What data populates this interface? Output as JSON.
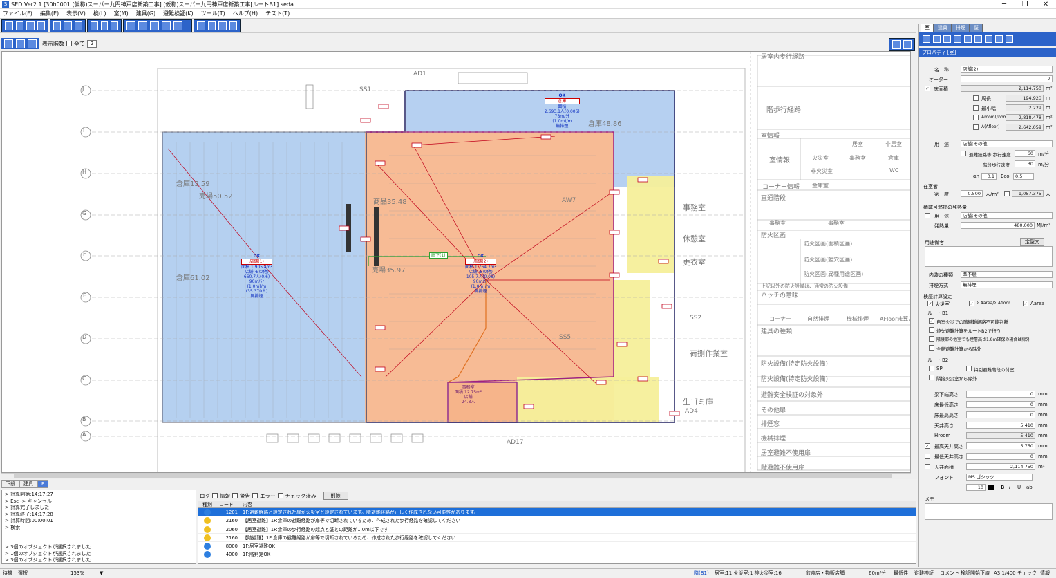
{
  "window": {
    "title": "SED Ver2.1 [30h0001 (仮称)スーパー九円神戸店新築工事] (仮称)スーパー九円神戸店新築工事[ルートB1].seda",
    "min": "─",
    "max": "❐",
    "close": "✕"
  },
  "menu": [
    "ファイル(F)",
    "編集(E)",
    "表示(V)",
    "検(L)",
    "室(M)",
    "建具(G)",
    "避難検証(K)",
    "ツール(T)",
    "ヘルプ(H)",
    "テスト(T)"
  ],
  "toolbar2": {
    "show_label": "表示階数",
    "all_label": "全て",
    "floor_value": "2"
  },
  "plan": {
    "grid_rows": [
      "J",
      "I",
      "H",
      "G",
      "F",
      "E",
      "D",
      "C",
      "B",
      "A"
    ],
    "room_large": {
      "status": "OK",
      "name": "店舗(1)",
      "line1": "面積 1,905.4m²",
      "line2": "店舗(その他)",
      "line3": "660.7人(0.6)",
      "line4": "90m/分",
      "line5": "(1.0m)/m",
      "line6": "(35.370人)",
      "line7": "無排煙"
    },
    "room_sales": {
      "status": "OK",
      "name": "店舗(2)",
      "line1": "面積 1,764.7m²",
      "line2": "店舗(その他)",
      "line3": "105.7人(0.06)",
      "line4": "90m/分",
      "line5": "(1.0m)/m",
      "line6": "無排煙"
    },
    "room_stock": {
      "status": "OK",
      "name": "倉庫",
      "line1": "面積",
      "line2": "2,693.1人(0.006)",
      "line3": "78m/分",
      "line4": "(1.0m)/m",
      "line5": "無排煙"
    },
    "room_small": {
      "name": "事務室",
      "line1": "面積 12.75m²",
      "line2": "店舗",
      "line3": "24.8人"
    },
    "corridor_tag": "廊下(1)",
    "labels": [
      "商品35.48",
      "売場50.52",
      "倉庫61.02",
      "売場35.97",
      "倉庫48.86",
      "倉庫13.59",
      "AW7",
      "SS2",
      "SS1",
      "SS5",
      "AD1",
      "AD4",
      "AD17",
      "事務室",
      "休憩室",
      "更衣室",
      "荷捌作業室",
      "生ゴミ庫"
    ]
  },
  "legend": {
    "title1": "居室内歩行経路",
    "rows": [
      "階歩行経路",
      "室情報",
      "コーナー情報",
      "直通階段",
      "防火区画",
      "ハッチの意味",
      "建具の種類",
      "防火設備(特定防火設備)",
      "防火設備(特定防火設備)",
      "避難安全検証の対象外",
      "その他扉",
      "排煙窓",
      "機械排煙",
      "居室避難不使用扉",
      "階避難不使用扉"
    ],
    "sub": [
      "居室",
      "非居室",
      "火災室",
      "事務室",
      "倉庫",
      "非火災室",
      "WC",
      "金庫室",
      "事務室",
      "事務室",
      "コーナー",
      "自然排煙",
      "機械排煙",
      "AFloor未算入"
    ],
    "notes": [
      "防火区画(面積区画)",
      "防火区画(竪穴区画)",
      "防火区画(異種用途区画)",
      "上記以外の防火設備は、通常の防火設備"
    ]
  },
  "bottom_tabs": [
    "下段",
    "建具",
    "F"
  ],
  "cmdlog": [
    "> 計算開始:14:17:27",
    "> Esc -> キャンセル",
    "> 計算完了しました",
    "> 計算終了:14:17:28",
    "> 計算時間:00:00:01",
    "> 検索",
    "",
    "",
    "> 3個のオブジェクトが選択されました",
    "> 1個のオブジェクトが選択されました",
    "> 3個のオブジェクトが選択されました"
  ],
  "messages": {
    "filters": {
      "log": "ログ",
      "info": "情報",
      "warn": "警告",
      "error": "エラー",
      "check": "チェック済み",
      "button": "削除"
    },
    "columns": [
      "種別",
      "コード",
      "内容"
    ],
    "rows": [
      {
        "type": "info",
        "code": "1201",
        "text": "1F:避難経路と設定された扉が火災室と設定されています。階避難経路が正しく作成されない可能性があります。"
      },
      {
        "type": "warn",
        "code": "2160",
        "text": "【居室避難】1F:倉庫の避難経路が扉等で切断されているため、作成された歩行経路を確認してください"
      },
      {
        "type": "warn",
        "code": "2060",
        "text": "【居室避難】1F:倉庫の歩行経路の起点と壁との距離が1.0m以下です"
      },
      {
        "type": "warn",
        "code": "2160",
        "text": "【階避難】1F:倉庫の避難経路が扉等で切断されているため、作成された歩行経路を確認してください"
      },
      {
        "type": "info",
        "code": "8000",
        "text": "1F:居室避難OK"
      },
      {
        "type": "info",
        "code": "4000",
        "text": "1F:階判定OK"
      }
    ]
  },
  "right_panel": {
    "tabs": [
      "室",
      "建具",
      "排煙",
      "壁"
    ],
    "prop_title": "プロパティ [室]",
    "name_label": "名　称",
    "name_value": "店舗(2)",
    "order_label": "オーダー",
    "order_value": "2",
    "floor_area_label": "床面積",
    "floor_area_value": "2,114.750",
    "unit_m2": "m²",
    "perimeter_label": "周長",
    "perimeter_value": "194.920",
    "unit_m": "m",
    "min_width_label": "最小幅",
    "min_width_value": "2.229",
    "area_room_label": "Aroom(room)",
    "area_room_value": "2,818.478",
    "afloor_label": "A(Afloor)",
    "afloor_value": "2,642.059",
    "usage_label": "用　途",
    "usage_value": "店舗(その他)",
    "corridor_label": "避難経路等 歩行速度",
    "corridor_value": "60",
    "unit_speed": "m/分",
    "stair_speed_label": "階段歩行速度",
    "stair_speed_value": "30",
    "alpha_label": "αn",
    "alpha_value": "0.1",
    "ecoa_label": "Eco",
    "ecoa_value": "0.5",
    "occupant_head": "在室者",
    "density_label": "密　度",
    "density_value": "0.500",
    "unit_density": "人/m²",
    "people_value": "1,057.375",
    "unit_people": "人",
    "fuel_head": "積載可燃物の発熱量",
    "fuel_usage_label": "用　途",
    "fuel_usage_value": "店舗(その他)",
    "heat_label": "発熱量",
    "heat_value": "480.000",
    "unit_heat": "MJ/m²",
    "note_label": "用途備考",
    "note_button": "定型文",
    "interior_label": "内装の種類",
    "interior_value": "準不燃",
    "smoke_label": "排煙方式",
    "smoke_value": "無排煙",
    "calc_head": "検証計算設定",
    "calc_fire": "火災室",
    "calc_area": "Σ Aarea/Σ Afloor",
    "calc_aarea": "Aarea",
    "routeb1_head": "ルートB1",
    "b1_opt1": "自室火災での階避難経路不可能判断",
    "b1_opt2": "焼失避難計算をルートB2で行う",
    "b1_opt3": "隣接部の他室でも煙層高さ1.8m確保の場合は除外",
    "b1_opt4": "全館避難計算から除外",
    "routeb2_head": "ルートB2",
    "b2_opt1": "SP",
    "b2_opt2": "特別避難階段の付室",
    "b2_opt3": "隣接火災室から除外",
    "h_label1": "梁下端高さ",
    "h_value1": "0",
    "h_label2": "床最低高さ",
    "h_value2": "0",
    "h_label3": "床最高高さ",
    "h_value3": "0",
    "h_label4": "天井高さ",
    "h_value4": "5,410",
    "h_label5": "Hroom",
    "h_value5": "5,410",
    "h_label6": "最高天井高さ",
    "h_value6": "5,750",
    "h_label7": "最低天井高さ",
    "h_value7": "0",
    "h_label8": "天井面積",
    "h_value8": "2,114.750",
    "unit_mm": "mm",
    "font_label": "フォント",
    "font_value": "MS ゴシック",
    "font_size": "10",
    "memo_label": "メモ"
  },
  "status": {
    "mode": "待機",
    "select": "選択",
    "zoom": "153%",
    "floor": "階(B1)",
    "rooms": "居室:11 火災室:1 排火災室:16",
    "spec": "飲食店・物販店舗",
    "speed": "60m/分",
    "f1": "最低件",
    "f2": "避難検証",
    "f3": "コメント",
    "f4": "検証開始",
    "f5": "下線",
    "f6": "A3 1/400",
    "f7": "チェック",
    "f8": "情報"
  },
  "colors": {
    "accent": "#2c63c9",
    "blue_zone": "#a9c8ee",
    "orange_zone": "#f6b48a",
    "yellow_zone": "#f5ef9a",
    "route": "#c0001a",
    "green": "#2ea02e"
  }
}
